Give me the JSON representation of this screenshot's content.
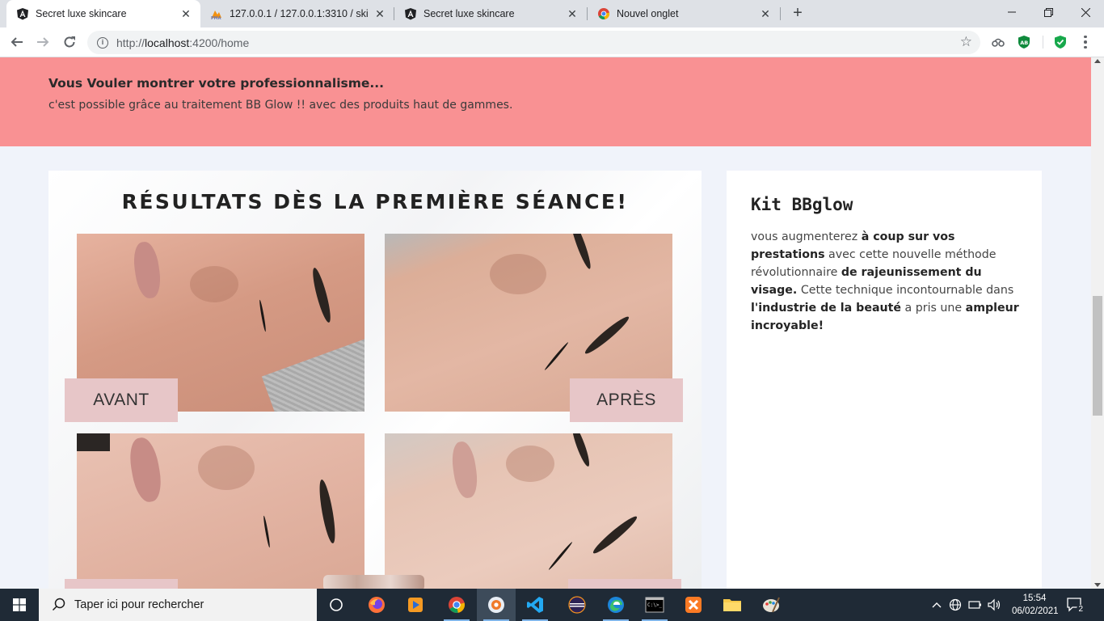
{
  "browser": {
    "tabs": [
      {
        "title": "Secret luxe skincare",
        "active": true,
        "favicon": "angular-icon"
      },
      {
        "title": "127.0.0.1 / 127.0.0.1:3310 / skincare",
        "active": false,
        "favicon": "phpmyadmin-icon"
      },
      {
        "title": "Secret luxe skincare",
        "active": false,
        "favicon": "angular-icon"
      },
      {
        "title": "Nouvel onglet",
        "active": false,
        "favicon": "chrome-icon"
      }
    ],
    "url": {
      "scheme": "http://",
      "host": "localhost",
      "path": ":4200/home"
    }
  },
  "page": {
    "promo": {
      "heading": "Vous Vouler montrer votre professionnalisme...",
      "text": "c'est possible grâce au traitement BB Glow !! avec des produits haut de gammes."
    },
    "results": {
      "title": "RÉSULTATS DÈS LA PREMIÈRE SÉANCE!",
      "before_label": "AVANT",
      "after_label": "APRÈS"
    },
    "kit": {
      "title": "Kit BBglow",
      "desc": {
        "p1": "vous augmenterez ",
        "b1": "à coup sur vos prestations",
        "p2": " avec cette nouvelle méthode révolutionnaire ",
        "b2": "de rajeunissement du visage.",
        "p3": " Cette technique incontournable dans ",
        "b3": "l'industrie de la beauté",
        "p4": " a pris une ",
        "b4": "ampleur incroyable!"
      }
    }
  },
  "taskbar": {
    "search_placeholder": "Taper ici pour rechercher",
    "time": "15:54",
    "date": "06/02/2021",
    "notifications": "2"
  },
  "colors": {
    "promo_bg": "#f99193",
    "label_bg": "#e7c6c8",
    "taskbar_bg": "#1f2a36"
  }
}
